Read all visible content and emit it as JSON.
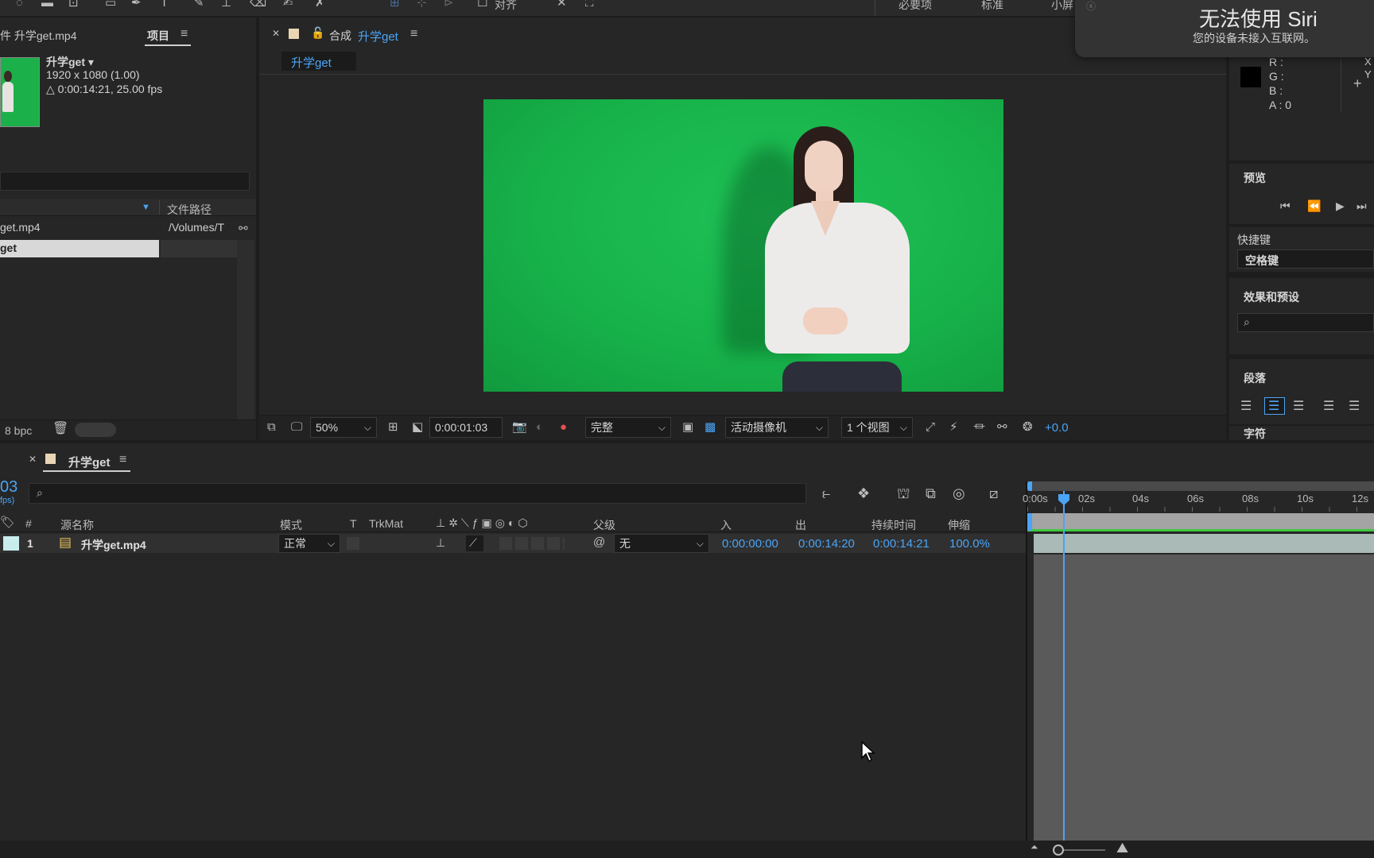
{
  "toolbar": {
    "align_label": "对齐",
    "workspaces": [
      "必要项",
      "标准",
      "小屏"
    ]
  },
  "siri": {
    "title": "无法使用 Siri",
    "message": "您的设备未接入互联网。"
  },
  "project": {
    "header_file": "件 升学get.mp4",
    "tab_label": "项目",
    "item_name": "升学get ▾",
    "item_resolution": "1920 x 1080 (1.00)",
    "item_duration": "△ 0:00:14:21, 25.00 fps",
    "col_filepath": "文件路径",
    "rows": [
      {
        "name": "get.mp4",
        "path": "/Volumes/T"
      },
      {
        "name": "get",
        "path": ""
      }
    ],
    "bpc": "8 bpc"
  },
  "composition": {
    "tab_prefix": "合成",
    "tab_name": "升学get",
    "subtab": "升学get",
    "zoom": "50%",
    "timecode": "0:00:01:03",
    "quality": "完整",
    "camera": "活动摄像机",
    "views": "1 个视图",
    "exposure": "+0.0"
  },
  "info": {
    "r": "R :",
    "g": "G :",
    "b": "B :",
    "a": "A : 0",
    "x": "X",
    "y": "Y"
  },
  "right_panels": {
    "preview_title": "预览",
    "shortcut_title": "快捷键",
    "shortcut_value": "空格键",
    "effects_title": "效果和预设",
    "paragraph_title": "段落",
    "character_title": "字符"
  },
  "timeline": {
    "tab_name": "升学get",
    "timecode_partial": "03",
    "fps_partial": "fps)",
    "columns": {
      "num": "#",
      "source": "源名称",
      "mode": "模式",
      "t": "T",
      "trkmat": "TrkMat",
      "parent": "父级",
      "in": "入",
      "out": "出",
      "duration": "持续时间",
      "stretch": "伸缩"
    },
    "layer": {
      "num": "1",
      "name": "升学get.mp4",
      "mode": "正常",
      "parent": "无",
      "in": "0:00:00:00",
      "out": "0:00:14:20",
      "duration": "0:00:14:21",
      "stretch": "100.0%"
    },
    "ruler": [
      "0:00s",
      "02s",
      "04s",
      "06s",
      "08s",
      "10s",
      "12s"
    ]
  },
  "colors": {
    "accent": "#4ba4f5",
    "green_screen": "#17b34a",
    "panel": "#262626",
    "panel_dark": "#1d1d1d"
  }
}
